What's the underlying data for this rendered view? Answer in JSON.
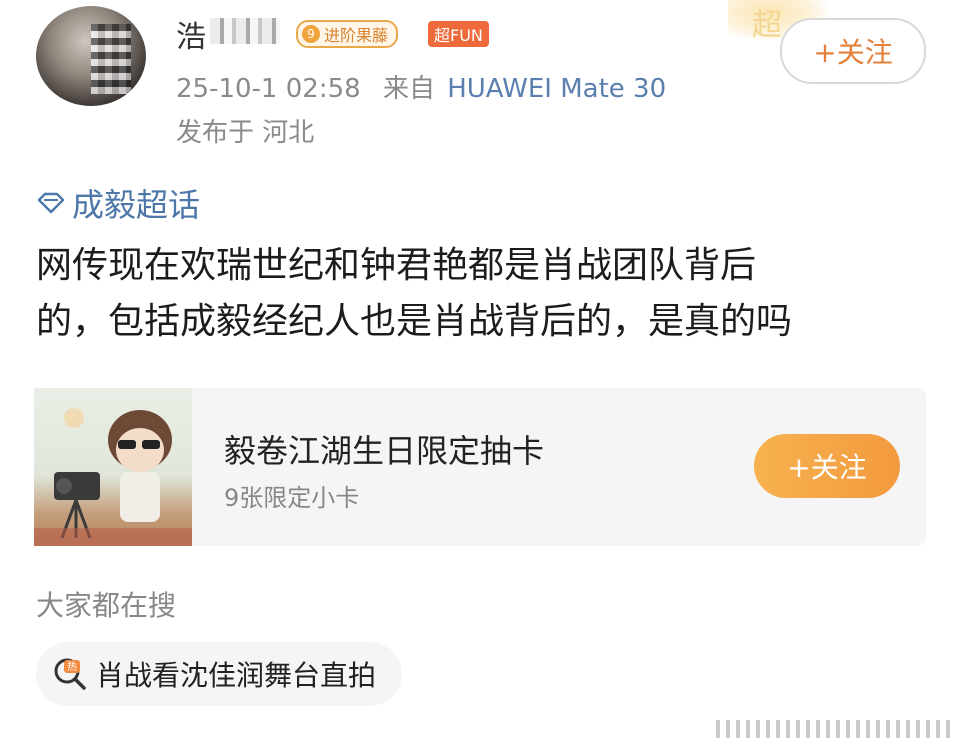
{
  "header": {
    "username": "浩",
    "badges": {
      "level_number": "9",
      "level_label": "进阶果藤",
      "fun_label": "超FUN"
    },
    "timestamp": "25-10-1 02:58",
    "source_prefix": "来自",
    "device": "HUAWEI Mate 30",
    "location": "发布于 河北",
    "decoration_text": "超",
    "follow_label": "+关注"
  },
  "post": {
    "topic": "成毅超话",
    "text_line1": "网传现在欢瑞世纪和钟君艳都是肖战团队背后",
    "text_line2": "的，包括成毅经纪人也是肖战背后的，是真的吗"
  },
  "card": {
    "title": "毅卷江湖生日限定抽卡",
    "subtitle": "9张限定小卡",
    "follow_label": "+关注"
  },
  "search": {
    "section_label": "大家都在搜",
    "query": "肖战看沈佳润舞台直拍",
    "icon_text": "热"
  },
  "colors": {
    "accent_orange": "#f39a3e",
    "link_blue": "#4c77a8",
    "meta_gray": "#8a8a8a"
  }
}
